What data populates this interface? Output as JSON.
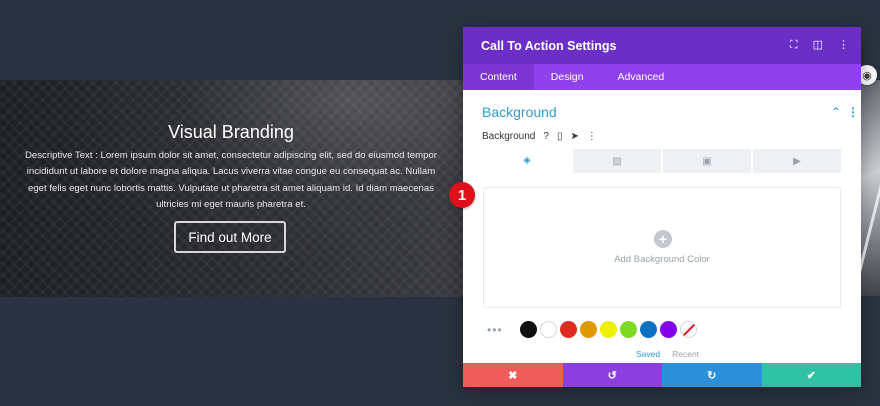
{
  "hero": {
    "title": "Visual Branding",
    "description": "Descriptive Text : Lorem ipsum dolor sit amet, consectetur adipiscing elit, sed do eiusmod tempor incididunt ut labore et dolore magna aliqua. Lacus viverra vitae congue eu consequat ac. Nullam eget felis eget nunc lobortis mattis. Vulputate ut pharetra sit amet aliquam id. Id diam maecenas ultricies mi eget mauris pharetra et.",
    "button_label": "Find out More"
  },
  "badge": {
    "number": "1"
  },
  "panel": {
    "title": "Call To Action Settings",
    "header_icons": [
      "fullscreen-icon",
      "split-view-icon",
      "more-vertical-icon"
    ],
    "tabs": [
      {
        "label": "Content",
        "active": true
      },
      {
        "label": "Design",
        "active": false
      },
      {
        "label": "Advanced",
        "active": false
      }
    ],
    "section_title": "Background",
    "background_label": "Background",
    "background_tabs": [
      "color-fill-icon",
      "gradient-icon",
      "image-icon",
      "video-icon"
    ],
    "add_color_label": "Add Background Color",
    "swatches": [
      "#111111",
      "#ffffff",
      "#e02b20",
      "#e09900",
      "#edf000",
      "#7cda24",
      "#0c71c3",
      "#8300e9"
    ],
    "saved_label": "Saved",
    "recent_label": "Recent",
    "footer": {
      "cancel_icon": "✖",
      "undo_icon": "↺",
      "redo_icon": "↻",
      "save_icon": "✔"
    }
  },
  "colors": {
    "header": "#6b2fc7",
    "tabs": "#8f42ec",
    "accent": "#2e9cd0",
    "cancel": "#ef5d5b",
    "undo": "#8b3fe0",
    "redo": "#2b8fd9",
    "save": "#2fc2a5",
    "badge": "#e0101b"
  }
}
